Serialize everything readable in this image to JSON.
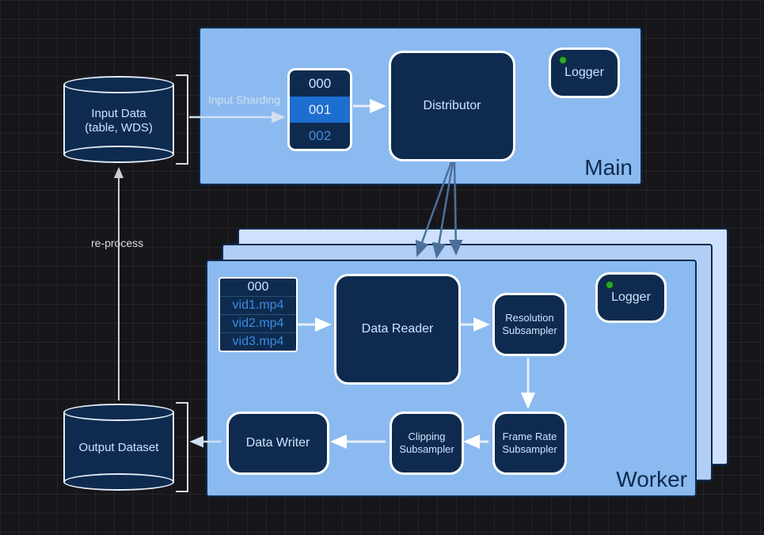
{
  "cylinders": {
    "input": {
      "line1": "Input Data",
      "line2": "(table, WDS)"
    },
    "output": {
      "label": "Output Dataset"
    }
  },
  "labels": {
    "input_sharding": "Input Sharding",
    "reprocess": "re-process"
  },
  "main": {
    "title": "Main",
    "shards": {
      "s0": "000",
      "s1": "001",
      "s2": "002"
    },
    "distributor": "Distributor",
    "logger": "Logger"
  },
  "worker": {
    "title": "Worker",
    "files": {
      "head": "000",
      "r1": "vid1.mp4",
      "r2": "vid2.mp4",
      "r3": "vid3.mp4"
    },
    "data_reader": "Data Reader",
    "resolution_sub": "Resolution\nSubsampler",
    "framerate_sub": "Frame Rate\nSubsampler",
    "clipping_sub": "Clipping\nSubsampler",
    "data_writer": "Data Writer",
    "logger": "Logger"
  }
}
